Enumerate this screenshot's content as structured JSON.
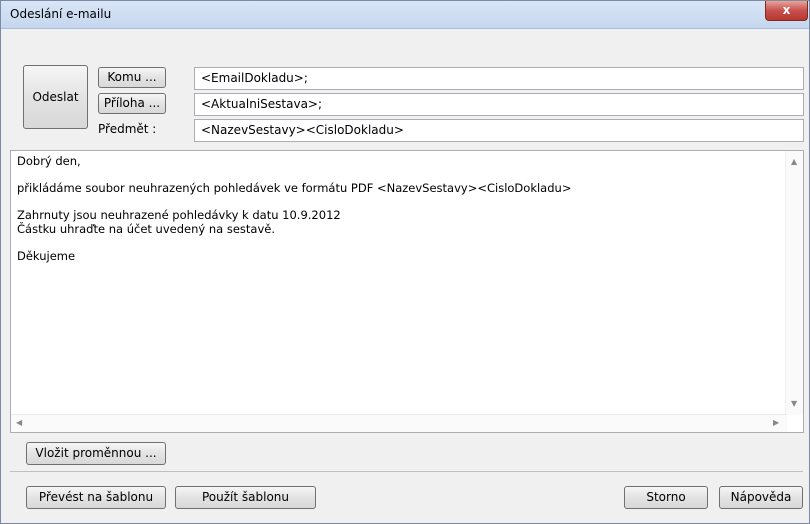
{
  "window": {
    "title": "Odeslání e-mailu",
    "close_label": "x"
  },
  "send": {
    "label": "Odeslat"
  },
  "fields": {
    "to_button": "Komu ...",
    "to_value": "<EmailDokladu>;",
    "attachment_button": "Příloha ...",
    "attachment_value": "<AktualniSestava>;",
    "subject_label": "Předmět :",
    "subject_value": "<NazevSestavy><CisloDokladu>"
  },
  "body": {
    "text": "Dobrý den,\n\npřikládáme soubor neuhrazených pohledávek ve formátu PDF <NazevSestavy><CisloDokladu>\n\nZahrnuty jsou neuhrazené pohledávky k datu 10.9.2012\nČástku uhraďte na účet uvedený na sestavě.\n\nDěkujeme"
  },
  "buttons": {
    "insert_variable": "Vložit proměnnou ...",
    "convert_template": "Převést na šablonu",
    "use_template": "Použít šablonu",
    "cancel": "Storno",
    "help": "Nápověda"
  },
  "icons": {
    "scroll_up": "scroll-up-arrow-icon",
    "scroll_down": "scroll-down-arrow-icon",
    "scroll_left": "scroll-left-arrow-icon",
    "scroll_right": "scroll-right-arrow-icon"
  }
}
